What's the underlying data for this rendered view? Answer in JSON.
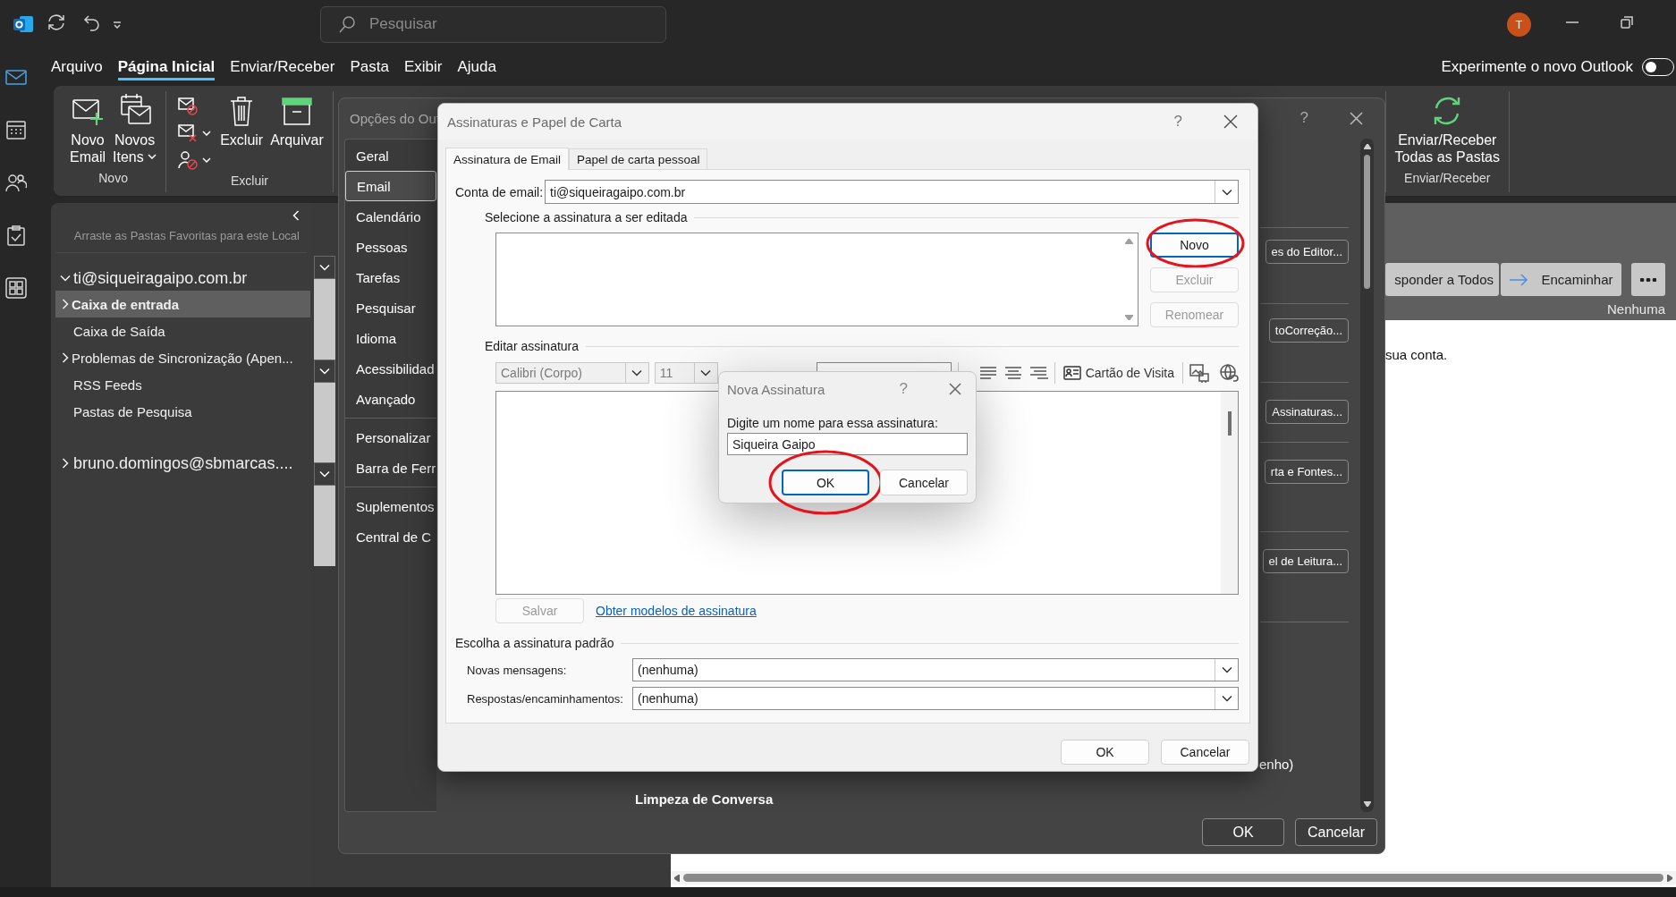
{
  "title_bar": {
    "search": {
      "placeholder": "Pesquisar"
    },
    "avatar": "T"
  },
  "nav_rail": {
    "items": [
      {
        "selected": true
      },
      {
        "selected": false
      },
      {
        "selected": false
      },
      {
        "selected": false
      },
      {
        "selected": false
      }
    ]
  },
  "menu": {
    "tabs": [
      {
        "label": "Arquivo",
        "selected": false
      },
      {
        "label": "Página Inicial",
        "selected": true
      },
      {
        "label": "Enviar/Receber",
        "selected": false
      },
      {
        "label": "Pasta",
        "selected": false
      },
      {
        "label": "Exibir",
        "selected": false
      },
      {
        "label": "Ajuda",
        "selected": false
      }
    ],
    "new_outlook": {
      "label": "Experimente o novo Outlook",
      "on": false
    }
  },
  "ribbon": {
    "groups": [
      {
        "label": "Novo",
        "items": [
          {
            "kind": "large",
            "label": "Novo\nEmail",
            "has_menu": false
          },
          {
            "kind": "large",
            "label": "Novos\nItens",
            "has_menu": true
          }
        ]
      },
      {
        "label": "Excluir",
        "items": [
          {
            "kind": "small",
            "has_menu": false
          },
          {
            "kind": "small",
            "has_menu": true
          },
          {
            "kind": "small",
            "has_menu": true
          },
          {
            "kind": "large",
            "label": "Excluir",
            "has_menu": false
          },
          {
            "kind": "large",
            "label": "Arquivar",
            "has_menu": false
          }
        ]
      },
      {
        "label": "Enviar/Receber",
        "items": [
          {
            "kind": "large",
            "label": "Enviar/Receber\nTodas as Pastas",
            "has_menu": false
          }
        ]
      }
    ]
  },
  "folder_pane": {
    "favorites_hint": "Arraste as Pastas Favoritas para este Local",
    "accounts": [
      {
        "name": "ti@siqueiragaipo.com.br",
        "expanded": true,
        "children": [
          {
            "name": "Caixa de entrada",
            "selected": true,
            "has_subfolders": true
          },
          {
            "name": "Caixa de Saída",
            "selected": false,
            "has_subfolders": false
          },
          {
            "name": "Problemas de Sincronização (Apen...",
            "selected": false,
            "has_subfolders": true
          },
          {
            "name": "RSS Feeds",
            "selected": false,
            "has_subfolders": false
          },
          {
            "name": "Pastas de Pesquisa",
            "selected": false,
            "has_subfolders": false
          }
        ]
      },
      {
        "name": "bruno.domingos@sbmarcas....",
        "expanded": false
      }
    ]
  },
  "reading_pane": {
    "actions": [
      {
        "kind": "reply-all",
        "label": "sponder a Todos"
      },
      {
        "kind": "forward",
        "label": "Encaminhar"
      }
    ],
    "category": "Nenhuma",
    "body_text": "sua conta."
  },
  "options_dialog": {
    "title": "Opções do Out",
    "help": "?",
    "nav_sections": [
      {
        "items": [
          {
            "label": "Geral",
            "selected": false
          },
          {
            "label": "Email",
            "selected": true
          },
          {
            "label": "Calendário",
            "selected": false
          },
          {
            "label": "Pessoas",
            "selected": false
          },
          {
            "label": "Tarefas",
            "selected": false
          },
          {
            "label": "Pesquisar",
            "selected": false
          },
          {
            "label": "Idioma",
            "selected": false
          },
          {
            "label": "Acessibilidad",
            "selected": false
          },
          {
            "label": "Avançado",
            "selected": false
          }
        ]
      },
      {
        "items": [
          {
            "label": "Personalizar",
            "selected": false
          },
          {
            "label": "Barra de Ferr",
            "selected": false
          }
        ]
      },
      {
        "items": [
          {
            "label": "Suplementos",
            "selected": false
          },
          {
            "label": "Central de C",
            "selected": false
          }
        ]
      }
    ],
    "side_buttons": [
      "es do Editor...",
      "toCorreção...",
      "Assinaturas...",
      "rta e Fontes...",
      "el de Leitura..."
    ],
    "partial_text": "enho)",
    "section_heading": "Limpeza de Conversa",
    "buttons": [
      "OK",
      "Cancelar"
    ]
  },
  "signature_dialog": {
    "title": "Assinaturas e Papel de Carta",
    "help": "?",
    "tabs": [
      {
        "label": "Assinatura de Email",
        "selected": true
      },
      {
        "label": "Papel de carta pessoal",
        "selected": false
      }
    ],
    "account": {
      "label": "Conta de email:",
      "value": "ti@siqueiragaipo.com.br"
    },
    "select_section": {
      "label": "Selecione a assinatura a ser editada",
      "buttons": [
        {
          "label": "Novo",
          "disabled": false,
          "focused": true,
          "highlighted": true
        },
        {
          "label": "Excluir",
          "disabled": true,
          "focused": false,
          "highlighted": false
        },
        {
          "label": "Renomear",
          "disabled": true,
          "focused": false,
          "highlighted": false
        }
      ]
    },
    "edit_section": {
      "label": "Editar assinatura",
      "font": {
        "value": "Calibri (Corpo)",
        "disabled": true
      },
      "size": {
        "value": "11",
        "disabled": true
      },
      "business_card": "Cartão de Visita",
      "save": {
        "label": "Salvar",
        "disabled": true
      },
      "link": "Obter modelos de assinatura"
    },
    "defaults": {
      "label": "Escolha a assinatura padrão",
      "fields": [
        {
          "label": "Novas mensagens:",
          "value": "(nenhuma)"
        },
        {
          "label": "Respostas/encaminhamentos:",
          "value": "(nenhuma)"
        }
      ]
    },
    "buttons": [
      "OK",
      "Cancelar"
    ]
  },
  "new_signature_dialog": {
    "title": "Nova Assinatura",
    "help": "?",
    "prompt": "Digite um nome para essa assinatura:",
    "value": "Siqueira Gaipo",
    "buttons": [
      {
        "label": "OK",
        "focused": true,
        "highlighted": true
      },
      {
        "label": "Cancelar",
        "focused": false,
        "highlighted": false
      }
    ]
  }
}
